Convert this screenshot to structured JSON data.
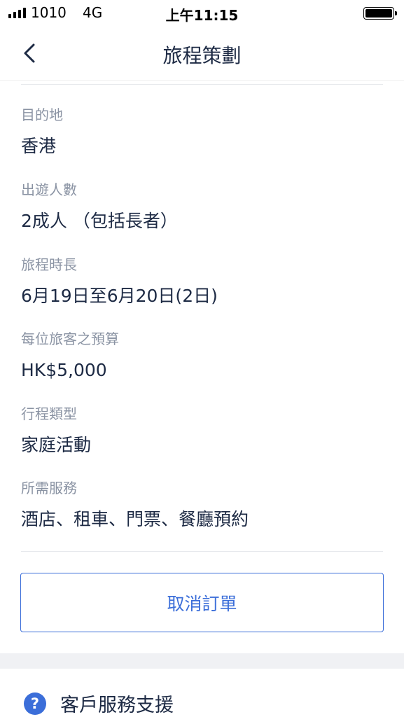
{
  "status_bar": {
    "carrier": "1010",
    "network": "4G",
    "time": "上午11:15"
  },
  "nav": {
    "title": "旅程策劃",
    "back_icon": "chevron-left-icon"
  },
  "fields": [
    {
      "label": "目的地",
      "value": "香港"
    },
    {
      "label": "出遊人數",
      "value": "2成人 （包括長者）"
    },
    {
      "label": "旅程時長",
      "value": "6月19日至6月20日(2日)"
    },
    {
      "label": "每位旅客之預算",
      "value": "HK$5,000"
    },
    {
      "label": "行程類型",
      "value": "家庭活動"
    },
    {
      "label": "所需服務",
      "value": "酒店、租車、門票、餐廳預約"
    }
  ],
  "actions": {
    "cancel_label": "取消訂單"
  },
  "support": {
    "label": "客戶服務支援",
    "icon": "question-circle-icon",
    "icon_glyph": "?"
  },
  "colors": {
    "accent": "#3b6ed9",
    "text": "#1d2a44",
    "label": "#8a93a3"
  }
}
